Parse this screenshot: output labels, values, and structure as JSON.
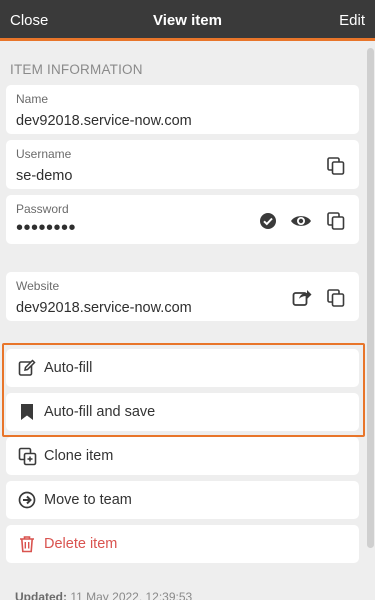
{
  "header": {
    "close_label": "Close",
    "title": "View item",
    "edit_label": "Edit",
    "accent_color": "#e8752a"
  },
  "section": {
    "label": "ITEM INFORMATION"
  },
  "fields": {
    "name": {
      "label": "Name",
      "value": "dev92018.service-now.com"
    },
    "username": {
      "label": "Username",
      "value": "se-demo",
      "icons": [
        "copy-icon"
      ]
    },
    "password": {
      "label": "Password",
      "value": "••••••••",
      "icons": [
        "check-circle-icon",
        "eye-icon",
        "copy-icon"
      ]
    },
    "website": {
      "label": "Website",
      "value": "dev92018.service-now.com",
      "icons": [
        "open-external-icon",
        "copy-icon"
      ]
    }
  },
  "actions": {
    "autofill": {
      "label": "Auto-fill",
      "icon": "edit-icon"
    },
    "autofill_save": {
      "label": "Auto-fill and save",
      "icon": "bookmark-icon"
    },
    "clone": {
      "label": "Clone item",
      "icon": "clone-icon"
    },
    "move": {
      "label": "Move to team",
      "icon": "arrow-circle-right-icon"
    },
    "delete": {
      "label": "Delete item",
      "icon": "trash-icon",
      "color": "#d9534f"
    }
  },
  "footer": {
    "updated_label": "Updated:",
    "updated_value": "11 May 2022, 12:39:53"
  }
}
